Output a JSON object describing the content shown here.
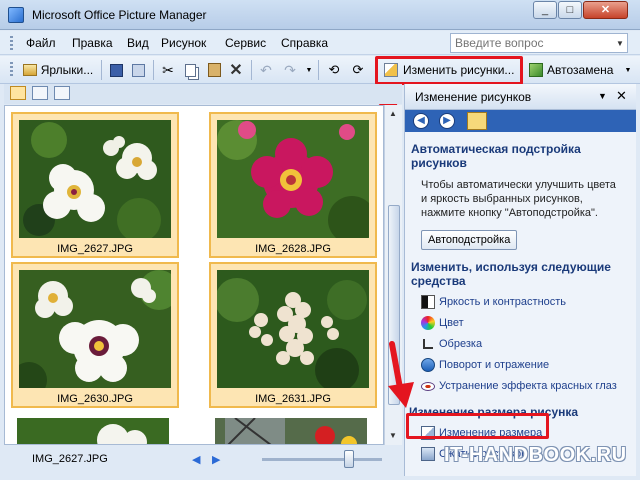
{
  "window": {
    "title": "Microsoft Office Picture Manager"
  },
  "menu": {
    "items": [
      "Файл",
      "Правка",
      "Вид",
      "Рисунок",
      "Сервис",
      "Справка"
    ],
    "search_placeholder": "Введите вопрос"
  },
  "toolbar": {
    "shortcuts_label": "Ярлыки...",
    "edit_pictures_label": "Изменить рисунки...",
    "autocorrect_label": "Автозамена"
  },
  "gallery": {
    "thumbnails": [
      {
        "caption": "IMG_2627.JPG",
        "selected": true
      },
      {
        "caption": "IMG_2628.JPG",
        "selected": true
      },
      {
        "caption": "IMG_2630.JPG",
        "selected": true
      },
      {
        "caption": "IMG_2631.JPG",
        "selected": true
      }
    ]
  },
  "status": {
    "filename": "IMG_2627.JPG"
  },
  "pane": {
    "title": "Изменение рисунков",
    "auto_section": {
      "title": "Автоматическая подстройка рисунков",
      "text": "Чтобы автоматически улучшить цвета и яркость выбранных рисунков, нажмите кнопку \"Автоподстройка\".",
      "button": "Автоподстройка"
    },
    "edit_section": {
      "title": "Изменить, используя следующие средства",
      "links": [
        "Яркость и контрастность",
        "Цвет",
        "Обрезка",
        "Поворот и отражение",
        "Устранение эффекта красных глаз"
      ]
    },
    "resize_section": {
      "title": "Изменение размера рисунка",
      "links": [
        "Изменение размера",
        "Сжатие рисунков"
      ]
    }
  },
  "watermark": "IT-HANDBOOK.RU",
  "colors": {
    "highlight": "#e4151f",
    "selection": "#fde5b3",
    "pane_nav": "#2e63b6"
  }
}
